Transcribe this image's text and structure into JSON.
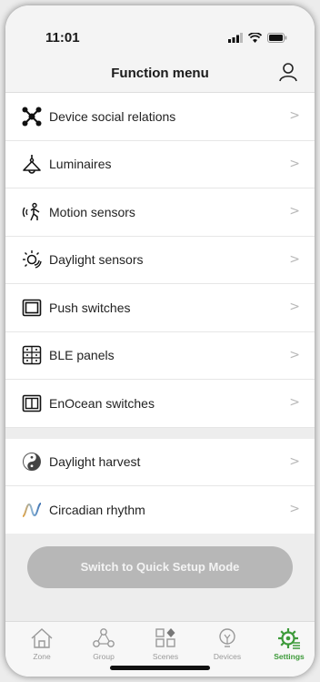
{
  "status": {
    "time": "11:01"
  },
  "header": {
    "title": "Function menu",
    "user_icon": "user-icon"
  },
  "menu_group1": [
    {
      "label": "Device social relations",
      "icon": "network-icon"
    },
    {
      "label": "Luminaires",
      "icon": "pendant-lamp-icon"
    },
    {
      "label": "Motion sensors",
      "icon": "motion-person-icon"
    },
    {
      "label": "Daylight sensors",
      "icon": "sun-icon"
    },
    {
      "label": "Push switches",
      "icon": "push-switch-icon"
    },
    {
      "label": "BLE panels",
      "icon": "ble-panel-icon"
    },
    {
      "label": "EnOcean switches",
      "icon": "enocean-switch-icon"
    }
  ],
  "menu_group2": [
    {
      "label": "Daylight harvest",
      "icon": "yin-yang-icon"
    },
    {
      "label": "Circadian rhythm",
      "icon": "wave-icon"
    }
  ],
  "chevron": ">",
  "quick_setup_button": "Switch to Quick Setup Mode",
  "tabs": [
    {
      "label": "Zone",
      "icon": "home-icon"
    },
    {
      "label": "Group",
      "icon": "group-icon"
    },
    {
      "label": "Scenes",
      "icon": "scenes-icon"
    },
    {
      "label": "Devices",
      "icon": "bulb-icon"
    },
    {
      "label": "Settings",
      "icon": "gear-icon",
      "active": true
    }
  ],
  "colors": {
    "accent_green": "#3d9a3a",
    "button_grey": "#b7b7b7"
  }
}
